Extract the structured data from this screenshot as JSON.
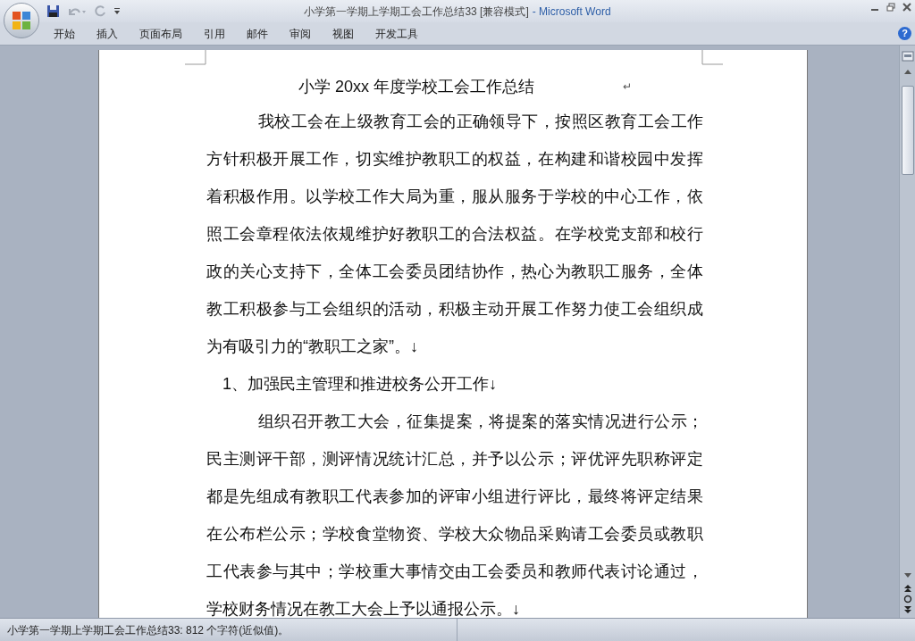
{
  "window": {
    "document_title": "小学第一学期上学期工会工作总结33 [兼容模式]",
    "app_title": "- Microsoft Word"
  },
  "ribbon_tabs": [
    {
      "label": "开始"
    },
    {
      "label": "插入"
    },
    {
      "label": "页面布局"
    },
    {
      "label": "引用"
    },
    {
      "label": "邮件"
    },
    {
      "label": "审阅"
    },
    {
      "label": "视图"
    },
    {
      "label": "开发工具"
    }
  ],
  "document": {
    "title": "小学 20xx 年度学校工会工作总结",
    "title_mark": "↵",
    "blocks": [
      {
        "kind": "paragraph",
        "lines": [
          "我校工会在上级教育工会的正确领导下，按照区教育工会工作",
          "方针积极开展工作，切实维护教职工的权益，在构建和谐校园中发挥",
          "着积极作用。以学校工作大局为重，服从服务于学校的中心工作，依",
          "照工会章程依法依规维护好教职工的合法权益。在学校党支部和校行",
          "政的关心支持下，全体工会委员团结协作，热心为教职工服务，全体",
          "教工积极参与工会组织的活动，积极主动开展工作努力使工会组织成",
          "为有吸引力的“教职工之家”。↓"
        ]
      },
      {
        "kind": "heading",
        "lines": [
          "1、加强民主管理和推进校务公开工作↓"
        ]
      },
      {
        "kind": "paragraph",
        "lines": [
          "组织召开教工大会，征集提案，将提案的落实情况进行公示；",
          "民主测评干部，测评情况统计汇总，并予以公示；评优评先职称评定",
          "都是先组成有教职工代表参加的评审小组进行评比，最终将评定结果",
          "在公布栏公示；学校食堂物资、学校大众物品采购请工会委员或教职",
          "工代表参与其中；学校重大事情交由工会委员和教师代表讨论通过，",
          "学校财务情况在教工大会上予以通报公示。↓"
        ]
      }
    ]
  },
  "help_button": {
    "glyph": "?"
  },
  "status_bar": {
    "text": "小学第一学期上学期工会工作总结33: 812 个字符(近似值)。"
  }
}
